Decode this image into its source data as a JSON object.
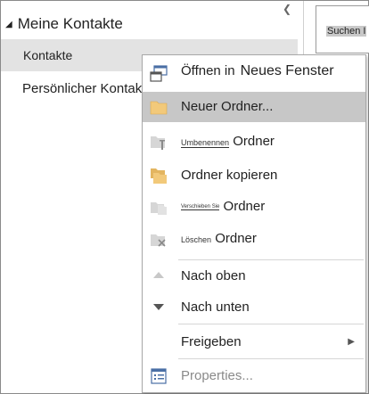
{
  "nav": {
    "root_label": "Meine Kontakte",
    "items": [
      {
        "label": "Kontakte"
      },
      {
        "label": "Persönlicher Kontakt."
      }
    ]
  },
  "search": {
    "label": "Suchen I"
  },
  "context_menu": {
    "open": {
      "prefix": "Öffnen in",
      "target": "Neues Fenster"
    },
    "new_folder": "Neuer Ordner...",
    "rename": {
      "small": "Umbenennen",
      "main": "Ordner"
    },
    "copy": "Ordner kopieren",
    "move": {
      "small": "Verschieben Sie",
      "main": "Ordner"
    },
    "delete": {
      "small": "Löschen",
      "main": "Ordner"
    },
    "move_up": "Nach oben",
    "move_down": "Nach unten",
    "share": "Freigeben",
    "properties": "Properties..."
  },
  "colors": {
    "folder": "#f2c97a",
    "folder_gray": "#d6d6d6",
    "highlight": "#c7c7c7",
    "selected": "#e3e3e3"
  }
}
